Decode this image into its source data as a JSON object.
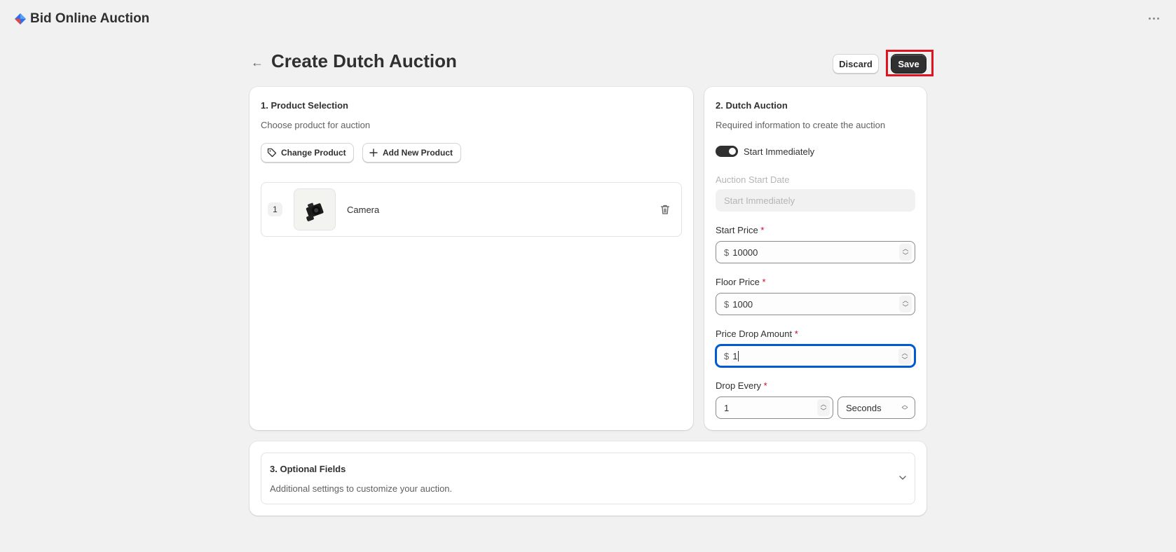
{
  "app": {
    "title": "Bid Online Auction"
  },
  "page": {
    "title": "Create Dutch Auction",
    "discard_label": "Discard",
    "save_label": "Save"
  },
  "product_selection": {
    "heading": "1. Product Selection",
    "subheading": "Choose product for auction",
    "change_product_label": "Change Product",
    "add_new_product_label": "Add New Product",
    "products": [
      {
        "index": "1",
        "name": "Camera"
      }
    ]
  },
  "dutch_auction": {
    "heading": "2. Dutch Auction",
    "subheading": "Required information to create the auction",
    "start_immediately_label": "Start Immediately",
    "start_immediately_on": true,
    "start_date_label": "Auction Start Date",
    "start_date_placeholder": "Start Immediately",
    "start_price_label": "Start Price",
    "start_price_value": "10000",
    "floor_price_label": "Floor Price",
    "floor_price_value": "1000",
    "price_drop_label": "Price Drop Amount",
    "price_drop_value": "1",
    "drop_every_label": "Drop Every",
    "drop_every_value": "1",
    "drop_every_unit": "Seconds",
    "currency_prefix": "$",
    "required_marker": "*"
  },
  "optional_fields": {
    "heading": "3. Optional Fields",
    "subheading": "Additional settings to customize your auction."
  },
  "colors": {
    "accent_focus": "#005bd3",
    "primary_button": "#303030",
    "highlight_outline": "#e0141e",
    "required": "#c70a24"
  }
}
